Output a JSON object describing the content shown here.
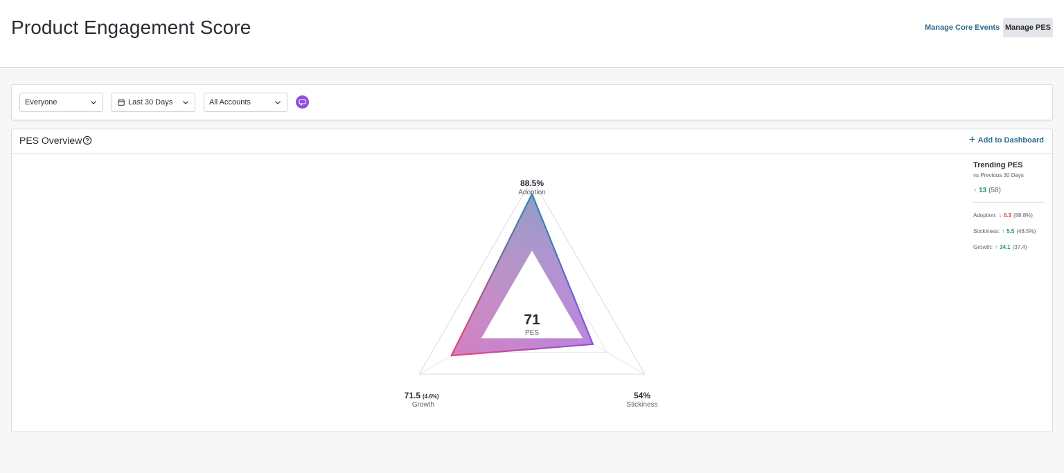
{
  "header": {
    "title": "Product Engagement Score",
    "manage_core_events": "Manage Core Events",
    "manage_pes": "Manage PES"
  },
  "filters": {
    "segment": "Everyone",
    "date_range": "Last 30 Days",
    "accounts": "All Accounts"
  },
  "overview": {
    "title": "PES Overview",
    "add_to_dashboard": "Add to Dashboard"
  },
  "chart_data": {
    "type": "radar",
    "score": "71",
    "score_label": "PES",
    "axes": [
      {
        "name": "Adoption",
        "display": "88.5%",
        "value": 88.5
      },
      {
        "name": "Stickiness",
        "display": "54%",
        "value": 54
      },
      {
        "name": "Growth",
        "display": "71.5",
        "extra": "(4.6%)",
        "value": 71.5
      }
    ],
    "ylim": [
      0,
      100
    ],
    "colors": {
      "adoption": "#2a8aa6",
      "stickiness": "#8e4fe0",
      "growth": "#e6457a"
    }
  },
  "trending": {
    "title": "Trending PES",
    "subtitle": "vs Previous 30 Days",
    "main_change": "13",
    "main_prev": "(58)",
    "rows": [
      {
        "label": "Adoption:",
        "direction": "down",
        "change": "0.3",
        "prev": "(88.8%)"
      },
      {
        "label": "Stickiness:",
        "direction": "up",
        "change": "5.5",
        "prev": "(48.5%)"
      },
      {
        "label": "Growth:",
        "direction": "up",
        "change": "34.1",
        "prev": "(37.4)"
      }
    ]
  },
  "colors": {
    "link": "#2b6b8a",
    "up": "#1c9a57",
    "down": "#d63a2f",
    "accent": "#8e4fe0"
  }
}
